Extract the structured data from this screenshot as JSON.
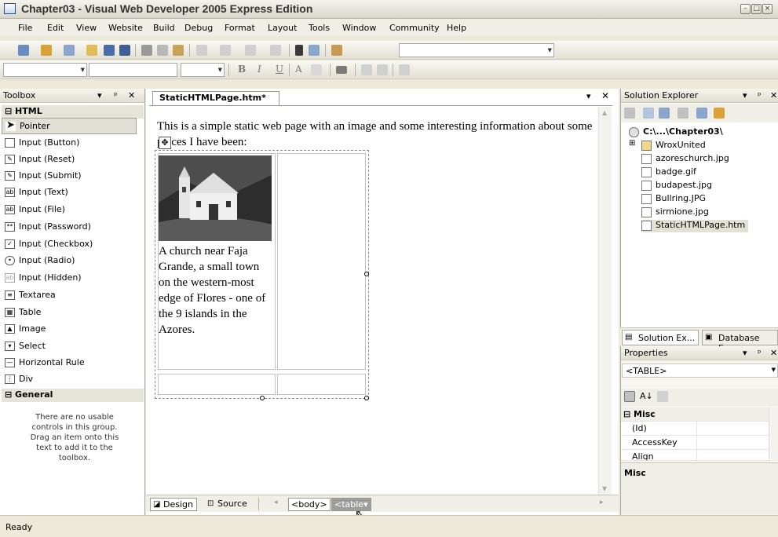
{
  "window": {
    "title": "Chapter03 - Visual Web Developer 2005 Express Edition"
  },
  "menubar": [
    "File",
    "Edit",
    "View",
    "Website",
    "Build",
    "Debug",
    "Format",
    "Layout",
    "Tools",
    "Window",
    "Community",
    "Help"
  ],
  "toolbox": {
    "title": "Toolbox",
    "group_html": "HTML",
    "items": [
      "Pointer",
      "Input (Button)",
      "Input (Reset)",
      "Input (Submit)",
      "Input (Text)",
      "Input (File)",
      "Input (Password)",
      "Input (Checkbox)",
      "Input (Radio)",
      "Input (Hidden)",
      "Textarea",
      "Table",
      "Image",
      "Select",
      "Horizontal Rule",
      "Div"
    ],
    "group_general": "General",
    "empty_message": "There are no usable controls in this group. Drag an item onto this text to add it to the toolbox."
  },
  "editor": {
    "tab_label": "StaticHTMLPage.htm*",
    "intro_text": "This is a simple static web page with an image and some interesting information about some places I have been:",
    "caption": "A church near Faja Grande, a small town on the western-most edge of Flores - one of the 9 islands in the Azores.",
    "view_design": "Design",
    "view_source": "Source",
    "crumb_body": "<body>",
    "crumb_table": "<table▾"
  },
  "solution_explorer": {
    "title": "Solution Explorer",
    "root": "C:\\...\\Chapter03\\",
    "items": [
      "WroxUnited",
      "azoreschurch.jpg",
      "badge.gif",
      "budapest.jpg",
      "Bullring.JPG",
      "sirmione.jpg",
      "StaticHTMLPage.htm"
    ],
    "tab_solution": "Solution Ex...",
    "tab_database": "Database E..."
  },
  "properties": {
    "title": "Properties",
    "selected_object": "<TABLE>",
    "category": "Misc",
    "rows": [
      "(Id)",
      "AccessKey",
      "Align"
    ],
    "description_title": "Misc"
  },
  "status_text": "Ready",
  "colors": {
    "selection": "#e2e0d6",
    "chrome": "#ece9d8"
  }
}
